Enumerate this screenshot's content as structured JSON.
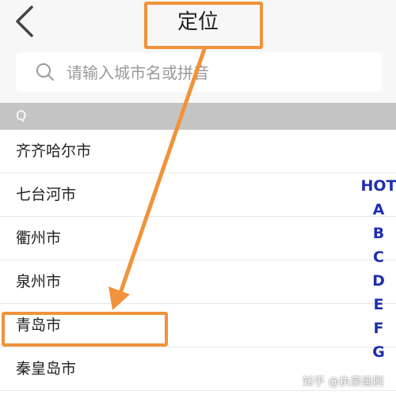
{
  "header": {
    "title": "定位",
    "back_icon": "chevron-left-icon"
  },
  "search": {
    "placeholder": "请输入城市名或拼音",
    "icon": "search-icon"
  },
  "section": {
    "letter": "Q"
  },
  "cities": [
    "齐齐哈尔市",
    "七台河市",
    "衢州市",
    "泉州市",
    "青岛市",
    "秦皇岛市"
  ],
  "index_bar": [
    "HOT",
    "A",
    "B",
    "C",
    "D",
    "E",
    "F",
    "G"
  ],
  "annotation": {
    "color": "#f0933a",
    "highlighted_city": "青岛市"
  },
  "watermark": "知乎 @执豪画刷"
}
